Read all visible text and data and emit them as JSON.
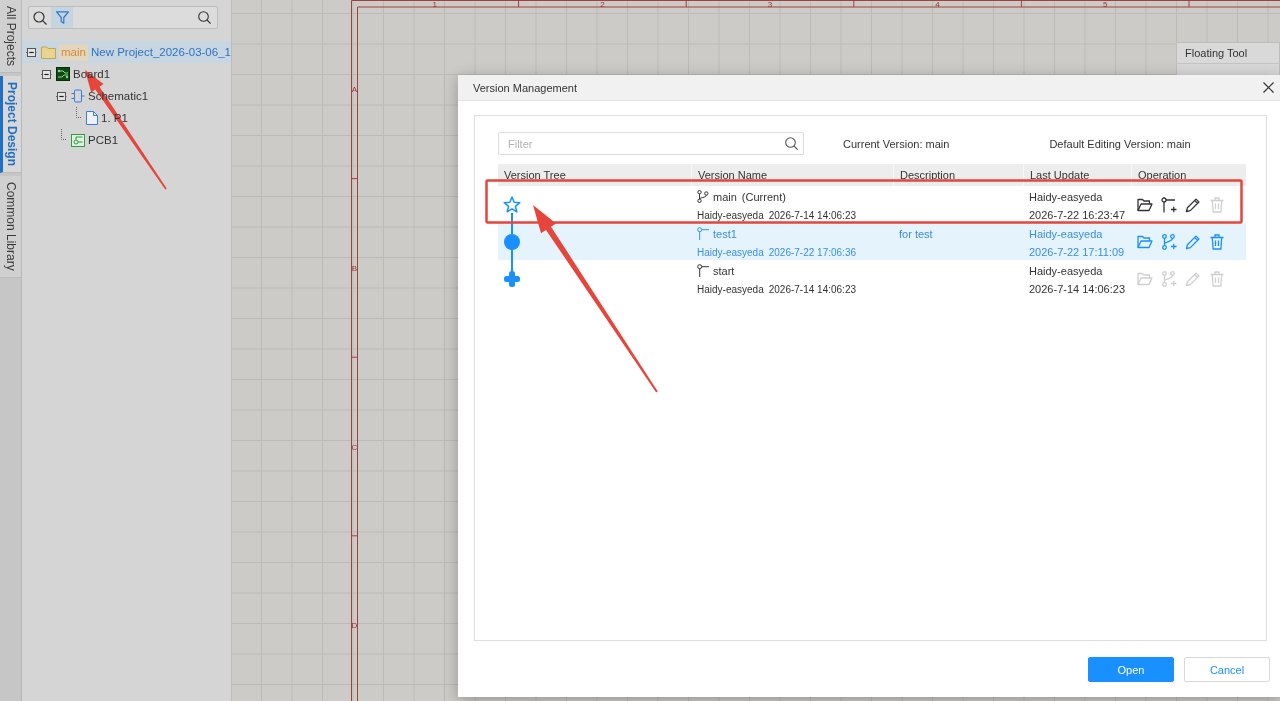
{
  "side_tabs": [
    {
      "label": "All Projects",
      "selected": false
    },
    {
      "label": "Project Design",
      "selected": true
    },
    {
      "label": "Common Library",
      "selected": false
    }
  ],
  "panel_search": {
    "filter_active": true
  },
  "project_tree": [
    {
      "kind": "project",
      "badge": "main",
      "label": "New Project_2026-03-06_1",
      "selected": true,
      "expanded": true,
      "children": [
        {
          "kind": "board",
          "label": "Board1",
          "selected": false,
          "expanded": true,
          "children": [
            {
              "kind": "schematic",
              "label": "Schematic1",
              "selected": false,
              "expanded": true,
              "children": [
                {
                  "kind": "page",
                  "label": "1. P1",
                  "selected": false
                }
              ]
            },
            {
              "kind": "pcb",
              "label": "PCB1",
              "selected": false
            }
          ]
        }
      ]
    }
  ],
  "schematic_frame": {
    "column_labels": [
      "1",
      "2",
      "3",
      "4",
      "5"
    ],
    "row_labels": [
      "A",
      "B",
      "C",
      "D"
    ]
  },
  "floating_tool": {
    "title": "Floating Tool"
  },
  "dialog": {
    "title": "Version Management",
    "filter": {
      "placeholder": "Filter"
    },
    "current_version": "Current Version: main",
    "default_editing_version": "Default Editing Version: main",
    "columns": [
      "Version Tree",
      "Version Name",
      "Description",
      "Last Update",
      "Operation"
    ],
    "versions": [
      {
        "kind": "current",
        "name": "main",
        "tag": "(Current)",
        "author": "Haidy-easyeda",
        "created": "2026-7-14 14:06:23",
        "updated_by": "Haidy-easyeda",
        "updated": "2026-7-22 16:23:47",
        "selected": false,
        "operations": [
          {
            "kind": "open",
            "disabled": false
          },
          {
            "kind": "new-branch",
            "disabled": false
          },
          {
            "kind": "edit",
            "disabled": false
          },
          {
            "kind": "delete",
            "disabled": true
          }
        ]
      },
      {
        "kind": "branch",
        "name": "test1",
        "author": "Haidy-easyeda",
        "created": "2026-7-22 17:06:36",
        "description": "for test",
        "updated_by": "Haidy-easyeda",
        "updated": "2026-7-22 17:11:09",
        "selected": true,
        "operations": [
          {
            "kind": "open",
            "disabled": false
          },
          {
            "kind": "merge",
            "disabled": false
          },
          {
            "kind": "edit",
            "disabled": false
          },
          {
            "kind": "delete",
            "disabled": false
          }
        ]
      },
      {
        "kind": "root",
        "name": "start",
        "author": "Haidy-easyeda",
        "created": "2026-7-14 14:06:23",
        "updated_by": "Haidy-easyeda",
        "updated": "2026-7-14 14:06:23",
        "selected": false,
        "operations": [
          {
            "kind": "open",
            "disabled": true
          },
          {
            "kind": "merge",
            "disabled": true
          },
          {
            "kind": "edit",
            "disabled": true
          },
          {
            "kind": "delete",
            "disabled": true
          }
        ]
      }
    ],
    "buttons": [
      {
        "label": "Open",
        "kind": "primary"
      },
      {
        "label": "Cancel",
        "kind": "secondary"
      }
    ]
  },
  "annotations": [
    {
      "kind": "rectangle"
    },
    {
      "kind": "arrow"
    },
    {
      "kind": "arrow"
    }
  ]
}
